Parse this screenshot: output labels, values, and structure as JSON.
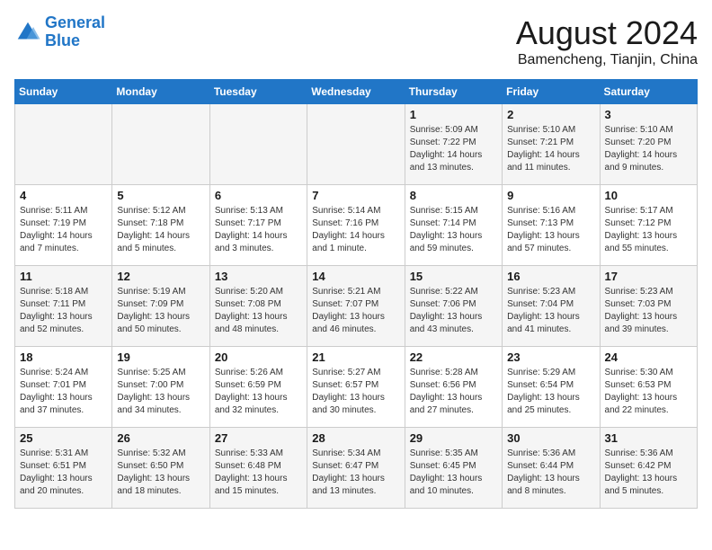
{
  "header": {
    "logo_line1": "General",
    "logo_line2": "Blue",
    "title": "August 2024",
    "subtitle": "Bamencheng, Tianjin, China"
  },
  "weekdays": [
    "Sunday",
    "Monday",
    "Tuesday",
    "Wednesday",
    "Thursday",
    "Friday",
    "Saturday"
  ],
  "weeks": [
    [
      {
        "day": "",
        "info": ""
      },
      {
        "day": "",
        "info": ""
      },
      {
        "day": "",
        "info": ""
      },
      {
        "day": "",
        "info": ""
      },
      {
        "day": "1",
        "info": "Sunrise: 5:09 AM\nSunset: 7:22 PM\nDaylight: 14 hours\nand 13 minutes."
      },
      {
        "day": "2",
        "info": "Sunrise: 5:10 AM\nSunset: 7:21 PM\nDaylight: 14 hours\nand 11 minutes."
      },
      {
        "day": "3",
        "info": "Sunrise: 5:10 AM\nSunset: 7:20 PM\nDaylight: 14 hours\nand 9 minutes."
      }
    ],
    [
      {
        "day": "4",
        "info": "Sunrise: 5:11 AM\nSunset: 7:19 PM\nDaylight: 14 hours\nand 7 minutes."
      },
      {
        "day": "5",
        "info": "Sunrise: 5:12 AM\nSunset: 7:18 PM\nDaylight: 14 hours\nand 5 minutes."
      },
      {
        "day": "6",
        "info": "Sunrise: 5:13 AM\nSunset: 7:17 PM\nDaylight: 14 hours\nand 3 minutes."
      },
      {
        "day": "7",
        "info": "Sunrise: 5:14 AM\nSunset: 7:16 PM\nDaylight: 14 hours\nand 1 minute."
      },
      {
        "day": "8",
        "info": "Sunrise: 5:15 AM\nSunset: 7:14 PM\nDaylight: 13 hours\nand 59 minutes."
      },
      {
        "day": "9",
        "info": "Sunrise: 5:16 AM\nSunset: 7:13 PM\nDaylight: 13 hours\nand 57 minutes."
      },
      {
        "day": "10",
        "info": "Sunrise: 5:17 AM\nSunset: 7:12 PM\nDaylight: 13 hours\nand 55 minutes."
      }
    ],
    [
      {
        "day": "11",
        "info": "Sunrise: 5:18 AM\nSunset: 7:11 PM\nDaylight: 13 hours\nand 52 minutes."
      },
      {
        "day": "12",
        "info": "Sunrise: 5:19 AM\nSunset: 7:09 PM\nDaylight: 13 hours\nand 50 minutes."
      },
      {
        "day": "13",
        "info": "Sunrise: 5:20 AM\nSunset: 7:08 PM\nDaylight: 13 hours\nand 48 minutes."
      },
      {
        "day": "14",
        "info": "Sunrise: 5:21 AM\nSunset: 7:07 PM\nDaylight: 13 hours\nand 46 minutes."
      },
      {
        "day": "15",
        "info": "Sunrise: 5:22 AM\nSunset: 7:06 PM\nDaylight: 13 hours\nand 43 minutes."
      },
      {
        "day": "16",
        "info": "Sunrise: 5:23 AM\nSunset: 7:04 PM\nDaylight: 13 hours\nand 41 minutes."
      },
      {
        "day": "17",
        "info": "Sunrise: 5:23 AM\nSunset: 7:03 PM\nDaylight: 13 hours\nand 39 minutes."
      }
    ],
    [
      {
        "day": "18",
        "info": "Sunrise: 5:24 AM\nSunset: 7:01 PM\nDaylight: 13 hours\nand 37 minutes."
      },
      {
        "day": "19",
        "info": "Sunrise: 5:25 AM\nSunset: 7:00 PM\nDaylight: 13 hours\nand 34 minutes."
      },
      {
        "day": "20",
        "info": "Sunrise: 5:26 AM\nSunset: 6:59 PM\nDaylight: 13 hours\nand 32 minutes."
      },
      {
        "day": "21",
        "info": "Sunrise: 5:27 AM\nSunset: 6:57 PM\nDaylight: 13 hours\nand 30 minutes."
      },
      {
        "day": "22",
        "info": "Sunrise: 5:28 AM\nSunset: 6:56 PM\nDaylight: 13 hours\nand 27 minutes."
      },
      {
        "day": "23",
        "info": "Sunrise: 5:29 AM\nSunset: 6:54 PM\nDaylight: 13 hours\nand 25 minutes."
      },
      {
        "day": "24",
        "info": "Sunrise: 5:30 AM\nSunset: 6:53 PM\nDaylight: 13 hours\nand 22 minutes."
      }
    ],
    [
      {
        "day": "25",
        "info": "Sunrise: 5:31 AM\nSunset: 6:51 PM\nDaylight: 13 hours\nand 20 minutes."
      },
      {
        "day": "26",
        "info": "Sunrise: 5:32 AM\nSunset: 6:50 PM\nDaylight: 13 hours\nand 18 minutes."
      },
      {
        "day": "27",
        "info": "Sunrise: 5:33 AM\nSunset: 6:48 PM\nDaylight: 13 hours\nand 15 minutes."
      },
      {
        "day": "28",
        "info": "Sunrise: 5:34 AM\nSunset: 6:47 PM\nDaylight: 13 hours\nand 13 minutes."
      },
      {
        "day": "29",
        "info": "Sunrise: 5:35 AM\nSunset: 6:45 PM\nDaylight: 13 hours\nand 10 minutes."
      },
      {
        "day": "30",
        "info": "Sunrise: 5:36 AM\nSunset: 6:44 PM\nDaylight: 13 hours\nand 8 minutes."
      },
      {
        "day": "31",
        "info": "Sunrise: 5:36 AM\nSunset: 6:42 PM\nDaylight: 13 hours\nand 5 minutes."
      }
    ]
  ]
}
